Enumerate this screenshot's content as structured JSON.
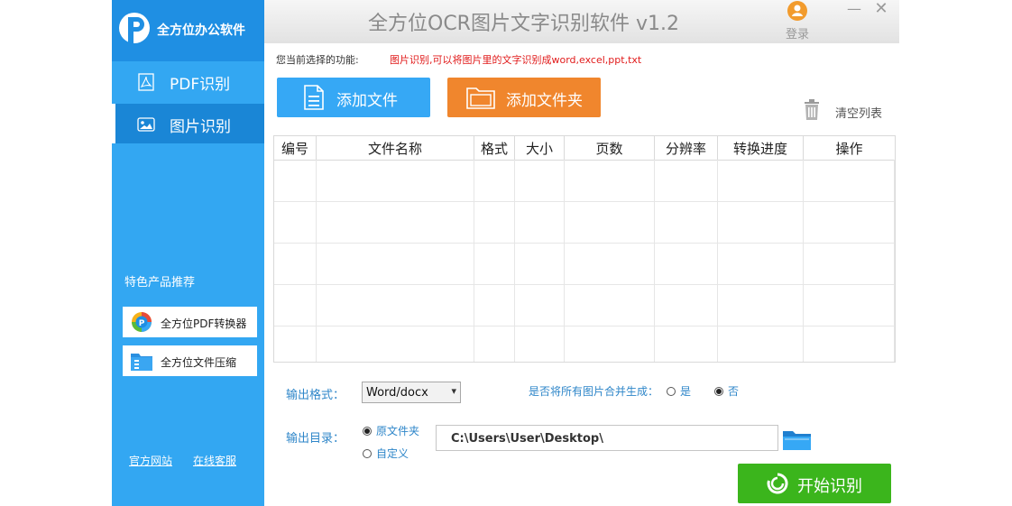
{
  "app": {
    "brand_name": "全方位办公软件",
    "title": "全方位OCR图片文字识别软件 v1.2",
    "login_label": "登录"
  },
  "sidebar": {
    "nav": [
      {
        "label": "PDF识别",
        "icon": "pdf-icon"
      },
      {
        "label": "图片识别",
        "icon": "image-icon",
        "active": true
      }
    ],
    "featured_title": "特色产品推荐",
    "products": [
      {
        "label": "全方位PDF转换器",
        "icon": "pdf-converter-logo"
      },
      {
        "label": "全方位文件压缩",
        "icon": "file-compress-logo"
      }
    ],
    "links": [
      "官方网站",
      "在线客服"
    ]
  },
  "main": {
    "current_function_label": "您当前选择的功能:",
    "current_function_desc": "图片识别,可以将图片里的文字识别成word,excel,ppt,txt",
    "add_file_label": "添加文件",
    "add_folder_label": "添加文件夹",
    "clear_list_label": "清空列表",
    "table": {
      "columns": [
        "编号",
        "文件名称",
        "格式",
        "大小",
        "页数",
        "分辨率",
        "转换进度",
        "操作"
      ],
      "rows": []
    },
    "output_format_label": "输出格式：",
    "output_format_value": "Word/docx",
    "merge_question": "是否将所有图片合并生成：",
    "merge_options": [
      {
        "label": "是",
        "selected": false
      },
      {
        "label": "否",
        "selected": true
      }
    ],
    "output_dir_label": "输出目录：",
    "output_dir_options": [
      {
        "label": "原文件夹",
        "selected": true
      },
      {
        "label": "自定义",
        "selected": false
      }
    ],
    "output_path": "C:\\Users\\User\\Desktop\\",
    "start_label": "开始识别"
  },
  "colors": {
    "sidebar": "#33a7f2",
    "add_file": "#36a8f5",
    "add_folder": "#f0862d",
    "start": "#3bb51c",
    "description_red": "#e11b1b",
    "label_blue": "#2e86c9"
  }
}
